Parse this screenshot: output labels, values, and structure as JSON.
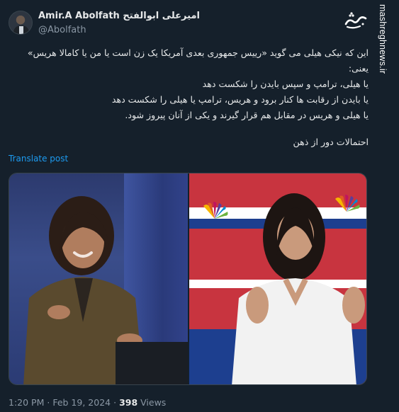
{
  "author": {
    "display_name": "Amir.A Abolfath امیرعلی ابوالفتح",
    "handle": "@Abolfath"
  },
  "tweet": {
    "lines": [
      "این که نیکی هیلی می گوید «رییس جمهوری بعدی آمریکا یک زن است یا من یا کامالا هریس»",
      "یعنی:",
      "یا هیلی، ترامپ و سپس بایدن را شکست دهد",
      "یا بایدن از رقابت ها کنار برود و هریس، ترامپ یا هیلی را شکست دهد",
      "یا هیلی و هریس در مقابل هم قرار گیرند و یکی از آنان پیروز شود.",
      "احتمالات دور از ذهن"
    ],
    "translate_label": "Translate post"
  },
  "watermark": {
    "text": "mashreghnews.ir",
    "logo_text": "مشرق"
  },
  "meta": {
    "time": "1:20 PM",
    "sep": "·",
    "date": "Feb 19, 2024",
    "views_count": "398",
    "views_label": "Views"
  },
  "colors": {
    "background": "#15202b",
    "text": "#e7e9ea",
    "muted": "#8b98a5",
    "link": "#1d9bf0"
  }
}
